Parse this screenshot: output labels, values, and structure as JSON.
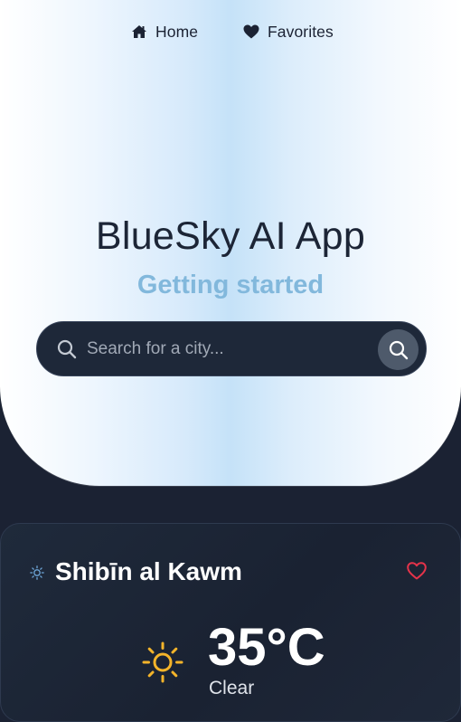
{
  "nav": {
    "items": [
      {
        "label": "Home",
        "icon": "home-icon"
      },
      {
        "label": "Favorites",
        "icon": "heart-icon"
      }
    ]
  },
  "hero": {
    "title": "BlueSky AI App",
    "subtitle": "Getting started"
  },
  "search": {
    "placeholder": "Search for a city...",
    "value": ""
  },
  "weather": {
    "city": "Shibīn al Kawm",
    "temperature": "35°C",
    "condition": "Clear",
    "condition_icon": "sun-icon",
    "favorite_icon": "heart-outline-icon"
  },
  "colors": {
    "page_background": "#1b2233",
    "subtitle": "#82b8dc",
    "sun": "#f4b42a",
    "favorite": "#e5334a",
    "search_bar": "#1e2839"
  }
}
